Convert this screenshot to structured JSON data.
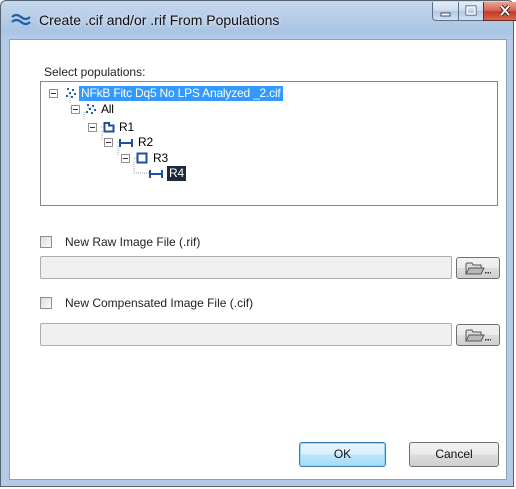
{
  "window": {
    "title": "Create .cif and/or .rif From Populations",
    "controls": [
      "minimize",
      "maximize",
      "close"
    ]
  },
  "populations": {
    "label": "Select populations:",
    "tree": [
      {
        "label": "NFkB Fitc Dq5 No LPS Analyzed _2.cif",
        "icon": "scatter-dots-icon",
        "selected": "blue"
      },
      {
        "label": "All",
        "icon": "scatter-dots-icon"
      },
      {
        "label": "R1",
        "icon": "polygon-gate-icon"
      },
      {
        "label": "R2",
        "icon": "line-gate-icon"
      },
      {
        "label": "R3",
        "icon": "rectangle-gate-icon"
      },
      {
        "label": "R4",
        "icon": "line-gate-icon",
        "selected": "dark"
      }
    ]
  },
  "raw_option": {
    "label": "New Raw Image File (.rif)",
    "checked": false,
    "path": ""
  },
  "comp_option": {
    "label": "New Compensated Image File (.cif)",
    "checked": false,
    "path": ""
  },
  "buttons": {
    "ok": "OK",
    "cancel": "Cancel"
  },
  "colors": {
    "selection_blue": "#3399ff",
    "selection_dark": "#1e2a3a",
    "titlebar": "#b9cee8",
    "close_red": "#c43a2c"
  }
}
